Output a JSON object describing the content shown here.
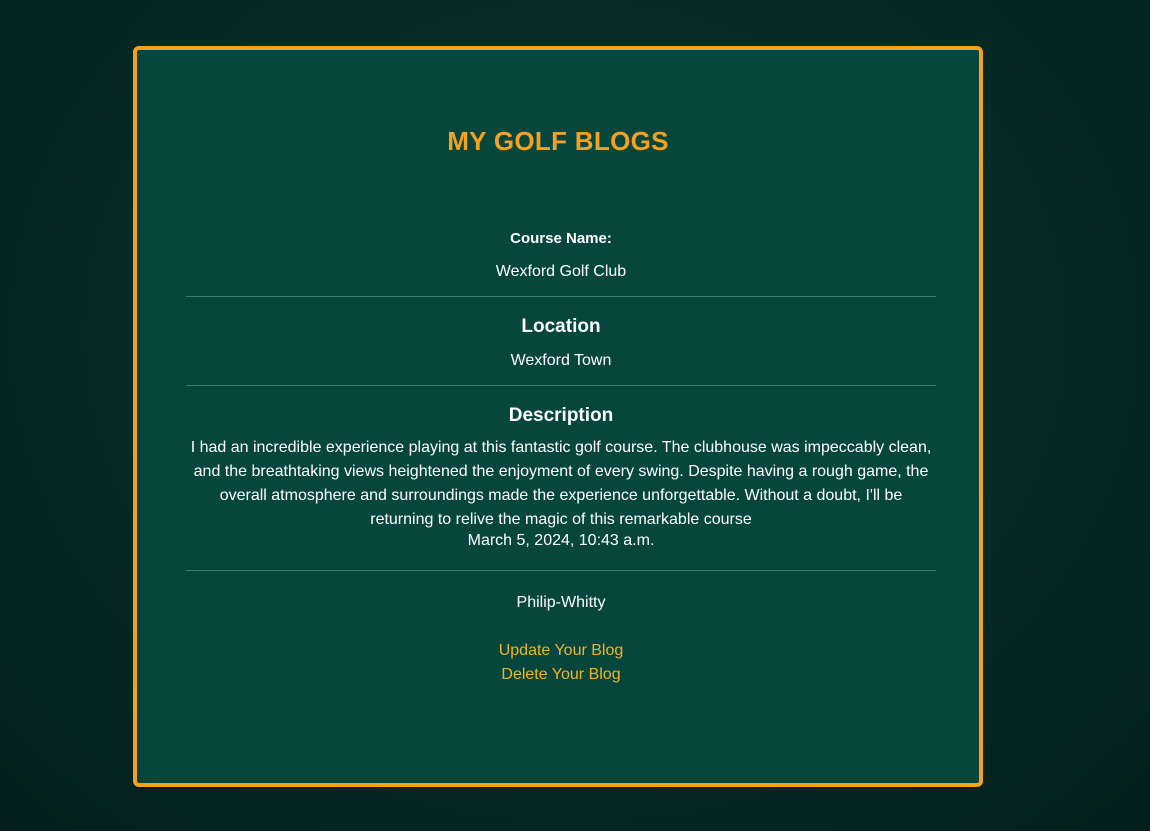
{
  "page": {
    "title": "MY GOLF BLOGS"
  },
  "blog": {
    "course_label": "Course Name:",
    "course_name": "Wexford Golf Club",
    "location_heading": "Location",
    "location": "Wexford Town",
    "description_heading": "Description",
    "description": "I had an incredible experience playing at this fantastic golf course. The clubhouse was impeccably clean, and the breathtaking views heightened the enjoyment of every swing. Despite having a rough game, the overall atmosphere and surroundings made the experience unforgettable. Without a doubt, I'll be returning to relive the magic of this remarkable course",
    "date": "March 5, 2024, 10:43 a.m.",
    "author": "Philip-Whitty"
  },
  "actions": {
    "update_label": "Update Your Blog",
    "delete_label": "Delete Your Blog"
  },
  "colors": {
    "background": "#062a25",
    "card": "#07463d",
    "accent": "#f5a020",
    "link": "#f0b429",
    "text": "#ffffff"
  }
}
